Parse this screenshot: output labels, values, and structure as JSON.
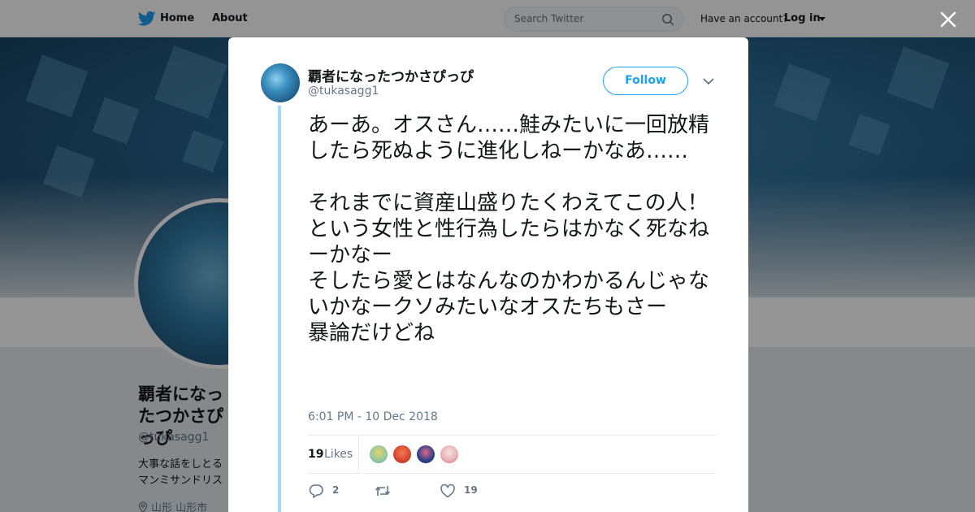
{
  "topbar": {
    "home_label": "Home",
    "about_label": "About",
    "search_placeholder": "Search Twitter",
    "have_account": "Have an account?",
    "login_label": "Log in"
  },
  "profile": {
    "name": "覇者になったつかさぴっぴ",
    "handle": "@tukasagg1",
    "bio": "大事な話をしとる\nマンミサンドリス",
    "location": "山形 山形市"
  },
  "tweet": {
    "author_name": "覇者になったつかさぴっぴ",
    "author_handle": "@tukasagg1",
    "follow_label": "Follow",
    "text": "あーあ。オスさん……鮭みたいに一回放精したら死ぬように進化しねーかなあ……\n\nそれまでに資産山盛りたくわえてこの人！という女性と性行為したらはかなく死なねーかなー\nそしたら愛とはなんなのかわかるんじゃないかなークソみたいなオスたちもさー\n暴論だけどね",
    "timestamp": "6:01 PM - 10 Dec 2018",
    "likes_count": "19",
    "likes_label": "Likes",
    "reply_count": "2",
    "retweet_count": "",
    "like_count": "19"
  },
  "colors": {
    "accent": "#1da1f2",
    "thread_line": "#a6d8f7",
    "secondary_text": "#657786",
    "liker_avatars": [
      "#8fc7a0",
      "#d8442e",
      "#2c3f8a",
      "#e8b4b8"
    ]
  },
  "icons": [
    "twitter-bird-icon",
    "search-icon",
    "caret-down-icon",
    "close-icon",
    "chevron-down-icon",
    "reply-icon",
    "retweet-icon",
    "heart-icon",
    "location-pin-icon"
  ]
}
